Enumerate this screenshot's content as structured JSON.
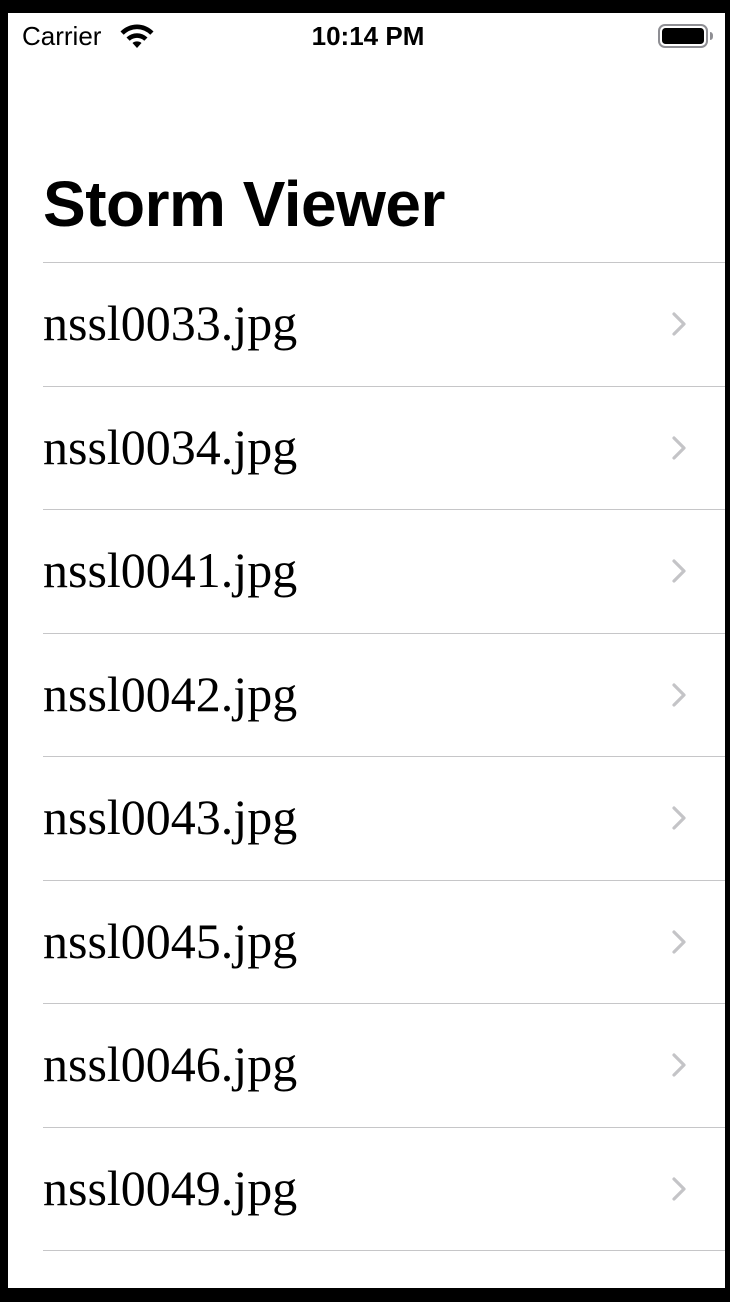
{
  "status_bar": {
    "carrier": "Carrier",
    "time": "10:14 PM",
    "icons": [
      "wifi-icon",
      "battery-icon"
    ]
  },
  "navigation": {
    "title": "Storm Viewer"
  },
  "list": {
    "items": [
      {
        "label": "nssl0033.jpg",
        "accessory": "chevron-right-icon"
      },
      {
        "label": "nssl0034.jpg",
        "accessory": "chevron-right-icon"
      },
      {
        "label": "nssl0041.jpg",
        "accessory": "chevron-right-icon"
      },
      {
        "label": "nssl0042.jpg",
        "accessory": "chevron-right-icon"
      },
      {
        "label": "nssl0043.jpg",
        "accessory": "chevron-right-icon"
      },
      {
        "label": "nssl0045.jpg",
        "accessory": "chevron-right-icon"
      },
      {
        "label": "nssl0046.jpg",
        "accessory": "chevron-right-icon"
      },
      {
        "label": "nssl0049.jpg",
        "accessory": "chevron-right-icon"
      }
    ]
  },
  "colors": {
    "background": "#ffffff",
    "text": "#000000",
    "separator": "#c6c6c8",
    "chevron": "#c4c4c7",
    "device_frame": "#000000"
  }
}
